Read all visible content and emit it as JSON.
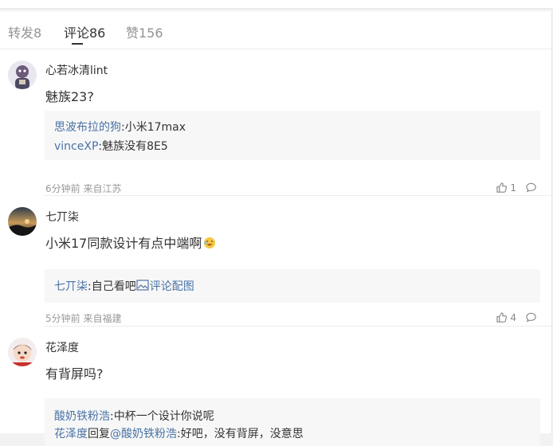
{
  "tabs": [
    {
      "label": "转发8"
    },
    {
      "label": "评论86"
    },
    {
      "label": "赞156"
    }
  ],
  "comments": [
    {
      "username": "心若冰清lint",
      "text": "魅族23?",
      "replies": [
        {
          "name": "思波布拉的狗",
          "sep": ":",
          "text": "小米17max"
        },
        {
          "name": "vinceXP",
          "sep": ":",
          "text": "魅族没有8E5"
        }
      ],
      "meta": "6分钟前 来自江苏",
      "likes": "1"
    },
    {
      "username": "七丌柒",
      "text": "小米17同款设计有点中端啊",
      "replies": [
        {
          "name": "七丌柒",
          "sep": ":",
          "text": "自己看吧",
          "image_link": "评论配图"
        }
      ],
      "meta": "5分钟前 来自福建",
      "likes": "4"
    },
    {
      "username": "花泽度",
      "text": "有背屏吗?",
      "replies": [
        {
          "name": "酸奶铁粉浩",
          "sep": ":",
          "text": "中杯一个设计你说呢"
        },
        {
          "name": "花泽度",
          "mid": "回复",
          "mention": "@酸奶铁粉浩",
          "sep": ":",
          "text": "好吧，没有背屏，没意思"
        }
      ]
    }
  ],
  "icons": {
    "like": "thumbs-up-icon",
    "reply": "comment-bubble-icon",
    "emoji": "laughing-emoji-icon",
    "image": "image-icon"
  },
  "colors": {
    "username_link": "#4a73a6",
    "text": "#333333",
    "meta": "#999999"
  }
}
